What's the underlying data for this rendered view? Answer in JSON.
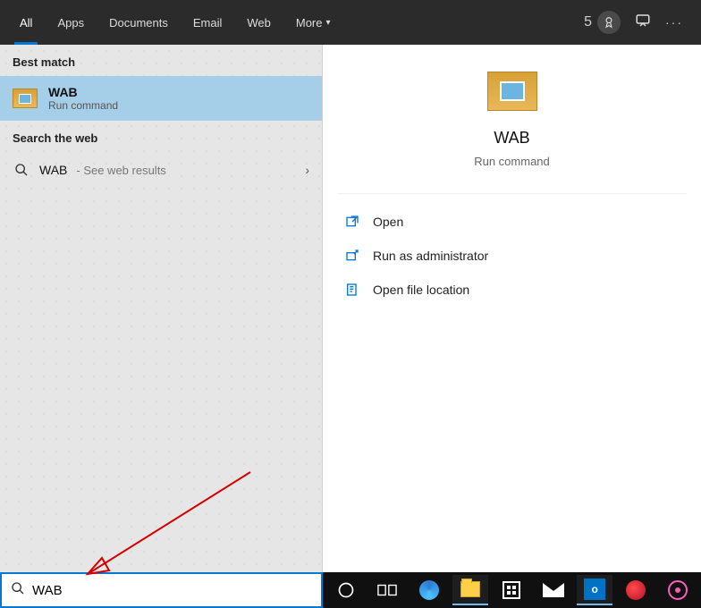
{
  "topbar": {
    "tabs": [
      "All",
      "Apps",
      "Documents",
      "Email",
      "Web",
      "More"
    ],
    "rewards_count": "5"
  },
  "left": {
    "best_match_header": "Best match",
    "result": {
      "title": "WAB",
      "subtitle": "Run command"
    },
    "web_header": "Search the web",
    "web_query": "WAB",
    "web_hint": " - See web results"
  },
  "preview": {
    "title": "WAB",
    "subtitle": "Run command",
    "actions": [
      "Open",
      "Run as administrator",
      "Open file location"
    ]
  },
  "search": {
    "value": "WAB"
  }
}
